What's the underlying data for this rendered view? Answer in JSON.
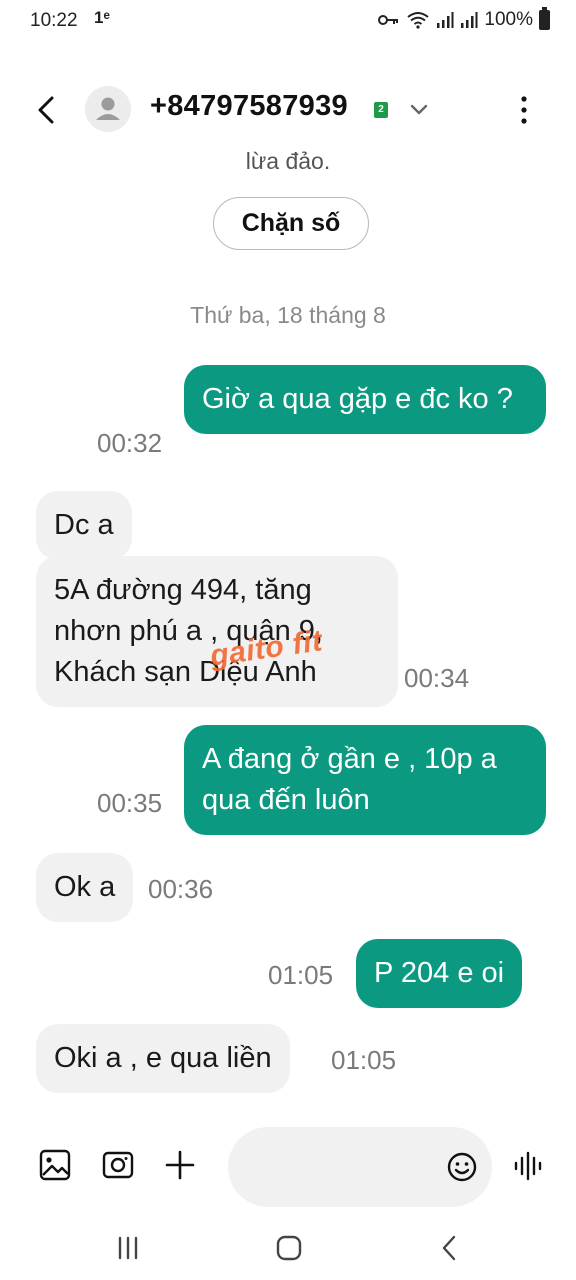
{
  "status_bar": {
    "time": "10:22",
    "notif_glyph": "1ᵉ",
    "battery": "100%",
    "icons": [
      "key-icon",
      "wifi-icon",
      "signal-icon",
      "signal-icon",
      "battery-icon"
    ]
  },
  "header": {
    "contact": "+84797587939",
    "sim_badge": "2",
    "colors": {
      "sim_badge": "#1e9a4b"
    }
  },
  "partial_text": "lừa đảo.",
  "block_button": "Chặn số",
  "date_separator": "Thứ ba, 18 tháng 8",
  "messages": [
    {
      "dir": "out",
      "text": "Giờ a qua gặp e đc ko ?",
      "time": "00:32"
    },
    {
      "dir": "in",
      "text": "Dc a",
      "time": ""
    },
    {
      "dir": "in",
      "text": "5A đường 494, tăng nhơn phú a , quận 9, Khách sạn Diệu Anh",
      "time": "00:34"
    },
    {
      "dir": "out",
      "text": "A đang ở gần e , 10p a qua đến luôn",
      "time": "00:35"
    },
    {
      "dir": "in",
      "text": "Ok a",
      "time": "00:36"
    },
    {
      "dir": "out",
      "text": "P 204 e oi",
      "time": "01:05"
    },
    {
      "dir": "in",
      "text": "Oki a , e qua liền",
      "time": "01:05"
    }
  ],
  "watermark": "gaito fit",
  "composer": {
    "input_value": "",
    "input_placeholder": "",
    "icons": [
      "gallery-icon",
      "camera-icon",
      "plus-icon",
      "emoji-icon",
      "voice-icon"
    ]
  },
  "nav": {
    "icons": [
      "recent-apps-icon",
      "home-icon",
      "back-icon"
    ]
  },
  "colors": {
    "outgoing": "#0b9a81",
    "incoming": "#f1f1f1",
    "time": "#7a7a7a"
  }
}
